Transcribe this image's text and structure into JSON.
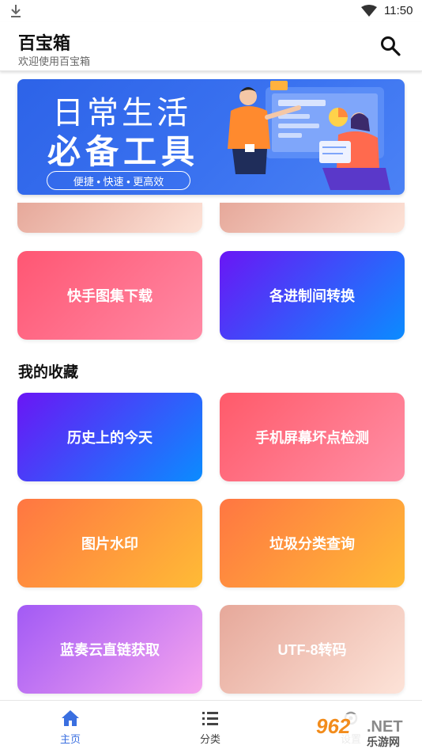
{
  "status_bar": {
    "time": "11:50"
  },
  "header": {
    "title": "百宝箱",
    "subtitle": "欢迎使用百宝箱"
  },
  "banner": {
    "line1": "日常生活",
    "line2": "必备工具",
    "tagline": "便捷 • 快速 • 更高效"
  },
  "tools": [
    {
      "label": "快手图集下载"
    },
    {
      "label": "各进制间转换"
    }
  ],
  "favorites": {
    "title": "我的收藏",
    "items": [
      {
        "label": "历史上的今天"
      },
      {
        "label": "手机屏幕坏点检测"
      },
      {
        "label": "图片水印"
      },
      {
        "label": "垃圾分类查询"
      },
      {
        "label": "蓝奏云直链获取"
      },
      {
        "label": "UTF-8转码"
      }
    ]
  },
  "bottom_nav": {
    "items": [
      {
        "label": "主页",
        "icon": "home-icon",
        "active": true
      },
      {
        "label": "分类",
        "icon": "list-icon",
        "active": false
      },
      {
        "label": "设置",
        "icon": "settings-icon",
        "active": false
      }
    ]
  },
  "watermark": {
    "text1": "962",
    "text2": ".NET",
    "text3": "乐游网"
  },
  "colors": {
    "accent": "#2d63e8",
    "nav_active": "#3a6fe0",
    "nav_inactive": "#444444"
  }
}
